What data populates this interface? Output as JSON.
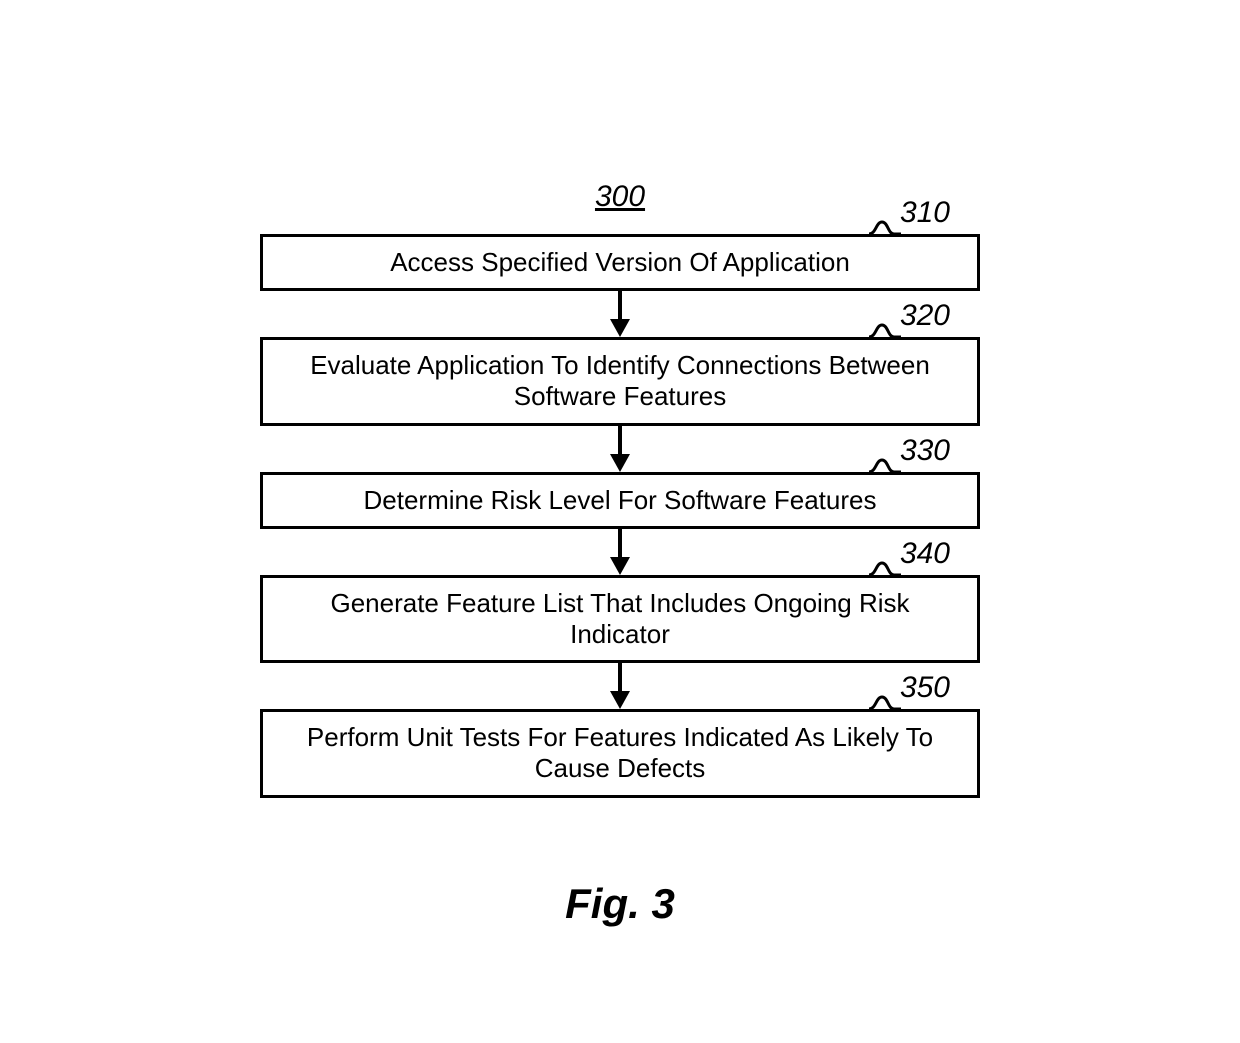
{
  "diagram": {
    "number": "300",
    "caption": "Fig. 3",
    "steps": [
      {
        "ref": "310",
        "text": "Access Specified Version Of Application"
      },
      {
        "ref": "320",
        "text": "Evaluate Application To Identify Connections Between Software Features"
      },
      {
        "ref": "330",
        "text": "Determine Risk Level For Software Features"
      },
      {
        "ref": "340",
        "text": "Generate Feature List That Includes Ongoing Risk Indicator"
      },
      {
        "ref": "350",
        "text": "Perform Unit Tests For Features Indicated As Likely To Cause Defects"
      }
    ]
  }
}
